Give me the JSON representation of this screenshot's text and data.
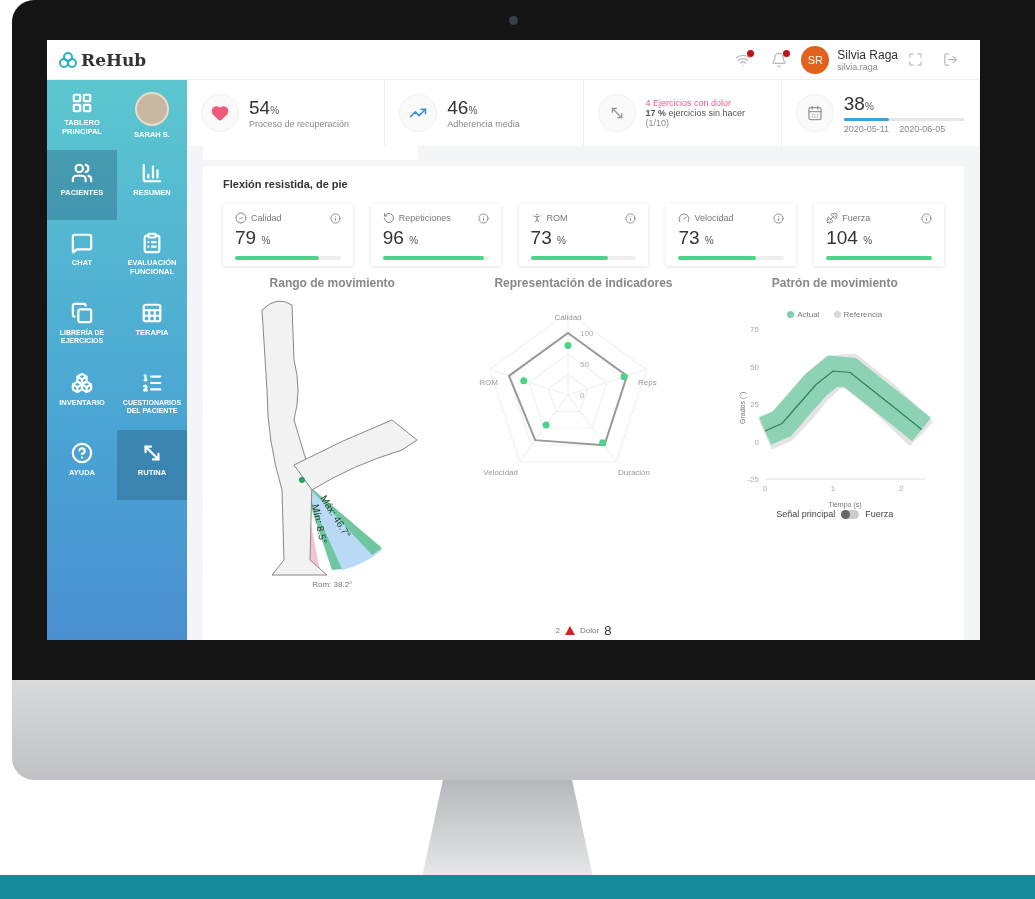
{
  "header": {
    "logo": "ReHub",
    "user": {
      "initials": "SR",
      "name": "Silvia Raga",
      "username": "silvia.raga"
    }
  },
  "sidebar": {
    "items": [
      {
        "kind": "nav",
        "label": "TABLERO PRINCIPAL",
        "selected": false
      },
      {
        "kind": "avatar",
        "label": "SARAH S.",
        "selected": false
      },
      {
        "kind": "nav",
        "label": "PACIENTES",
        "selected": true
      },
      {
        "kind": "nav",
        "label": "RESUMEN",
        "selected": false
      },
      {
        "kind": "nav",
        "label": "CHAT",
        "selected": false
      },
      {
        "kind": "nav",
        "label": "EVALUACIÓN FUNCIONAL",
        "selected": false
      },
      {
        "kind": "nav",
        "label": "LIBRERÍA DE EJERCICIOS",
        "selected": false
      },
      {
        "kind": "nav",
        "label": "TERAPIA",
        "selected": false
      },
      {
        "kind": "nav",
        "label": "INVENTARIO",
        "selected": false
      },
      {
        "kind": "nav",
        "label": "CUESTIONARIOS DEL PACIENTE",
        "selected": false
      },
      {
        "kind": "nav",
        "label": "AYUDA",
        "selected": false
      },
      {
        "kind": "nav",
        "label": "RUTINA",
        "selected": true
      }
    ]
  },
  "stats": [
    {
      "kind": "percent",
      "value": "54",
      "unit": "%",
      "label": "Proceso de recuperación"
    },
    {
      "kind": "percent",
      "value": "46",
      "unit": "%",
      "label": "Adherencia media"
    },
    {
      "kind": "alert",
      "alert": "4 Ejercicios con dolor",
      "detail": "**17 %** ejercicios sin hacer",
      "count": "(1/10)"
    },
    {
      "kind": "progress",
      "value": "38",
      "unit": "%",
      "level": 0.38,
      "start": "2020-05-11",
      "end": "2020-06-05"
    }
  ],
  "exercise": {
    "title": "Flexión resistida, de pie",
    "metrics": [
      {
        "label": "Calidad",
        "value": "79",
        "unit": "%",
        "level": 0.79
      },
      {
        "label": "Repeticiones",
        "value": "96",
        "unit": "%",
        "level": 0.96
      },
      {
        "label": "ROM",
        "value": "73",
        "unit": "%",
        "level": 0.73
      },
      {
        "label": "Velocidad",
        "value": "73",
        "unit": "%",
        "level": 0.73
      },
      {
        "label": "Fuerza",
        "value": "104",
        "unit": "%",
        "level": 1
      }
    ],
    "range": {
      "title": "Rango de movimiento",
      "max": "Máx: 46.7°",
      "min": "Mín: 8.5°",
      "rom": "Rom: 38.2°"
    },
    "radar": {
      "title": "Representación de indicadores",
      "axes": [
        "Calidad",
        "Reps",
        "Duración",
        "Velocidad",
        "ROM"
      ],
      "ticks": [
        "100",
        "50",
        "0"
      ],
      "pain": {
        "count": "2",
        "label": "Dolor",
        "value": "8"
      }
    },
    "pattern": {
      "title": "Patrón de movimiento",
      "chart_data": {
        "type": "line",
        "legend": "top",
        "xlabel": "Tiempo (s)",
        "ylabel": "Grados (°)",
        "x": [
          0,
          0.25,
          0.5,
          0.75,
          1,
          1.25,
          1.5,
          1.75,
          2,
          2.3
        ],
        "xlim": [
          0,
          2.35
        ],
        "ylim": [
          -25,
          75
        ],
        "xticks": [
          0,
          1,
          2
        ],
        "yticks": [
          -25,
          0,
          25,
          50,
          75
        ],
        "series": [
          {
            "name": "Actual",
            "color": "#7fcfae",
            "values": [
              7,
              12,
              25,
              38,
              47,
              46,
              37,
              28,
              19,
              8
            ]
          },
          {
            "name": "Referencia",
            "color": "#d8d8d8",
            "values": [
              5,
              10,
              22,
              36,
              46,
              47,
              38,
              29,
              18,
              5
            ]
          }
        ]
      },
      "signal": {
        "label": "Señal principal",
        "option": "Fuerza",
        "on": false
      }
    }
  }
}
